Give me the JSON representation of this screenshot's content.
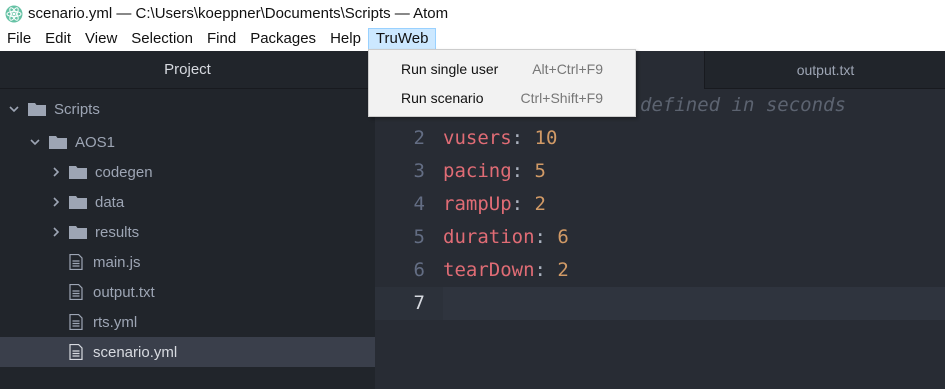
{
  "window": {
    "title": "scenario.yml — C:\\Users\\koeppner\\Documents\\Scripts — Atom"
  },
  "menu": [
    "File",
    "Edit",
    "View",
    "Selection",
    "Find",
    "Packages",
    "Help",
    "TruWeb"
  ],
  "truweb_menu": [
    {
      "label": "Run single user",
      "shortcut": "Alt+Ctrl+F9"
    },
    {
      "label": "Run scenario",
      "shortcut": "Ctrl+Shift+F9"
    }
  ],
  "tree": {
    "header": "Project",
    "items": [
      {
        "label": "Scripts",
        "type": "folder",
        "expanded": true,
        "level": 0
      },
      {
        "label": "AOS1",
        "type": "folder",
        "expanded": true,
        "level": 1
      },
      {
        "label": "codegen",
        "type": "folder",
        "expanded": false,
        "level": 2
      },
      {
        "label": "data",
        "type": "folder",
        "expanded": false,
        "level": 2
      },
      {
        "label": "results",
        "type": "folder",
        "expanded": false,
        "level": 2
      },
      {
        "label": "main.js",
        "type": "file",
        "level": 2
      },
      {
        "label": "output.txt",
        "type": "file",
        "level": 2
      },
      {
        "label": "rts.yml",
        "type": "file",
        "level": 2
      },
      {
        "label": "scenario.yml",
        "type": "file",
        "level": 2,
        "selected": true
      }
    ]
  },
  "tabs": {
    "inactive": "output.txt"
  },
  "editor": {
    "comment_visible": "defined in seconds",
    "lines": [
      {
        "num": "2",
        "key": "vusers",
        "sep": ": ",
        "value": "10"
      },
      {
        "num": "3",
        "key": "pacing",
        "sep": ": ",
        "value": "5"
      },
      {
        "num": "4",
        "key": "rampUp",
        "sep": ": ",
        "value": "2"
      },
      {
        "num": "5",
        "key": "duration",
        "sep": ": ",
        "value": "6"
      },
      {
        "num": "6",
        "key": "tearDown",
        "sep": ": ",
        "value": "2"
      },
      {
        "num": "7",
        "key": "",
        "sep": "",
        "value": ""
      }
    ]
  }
}
